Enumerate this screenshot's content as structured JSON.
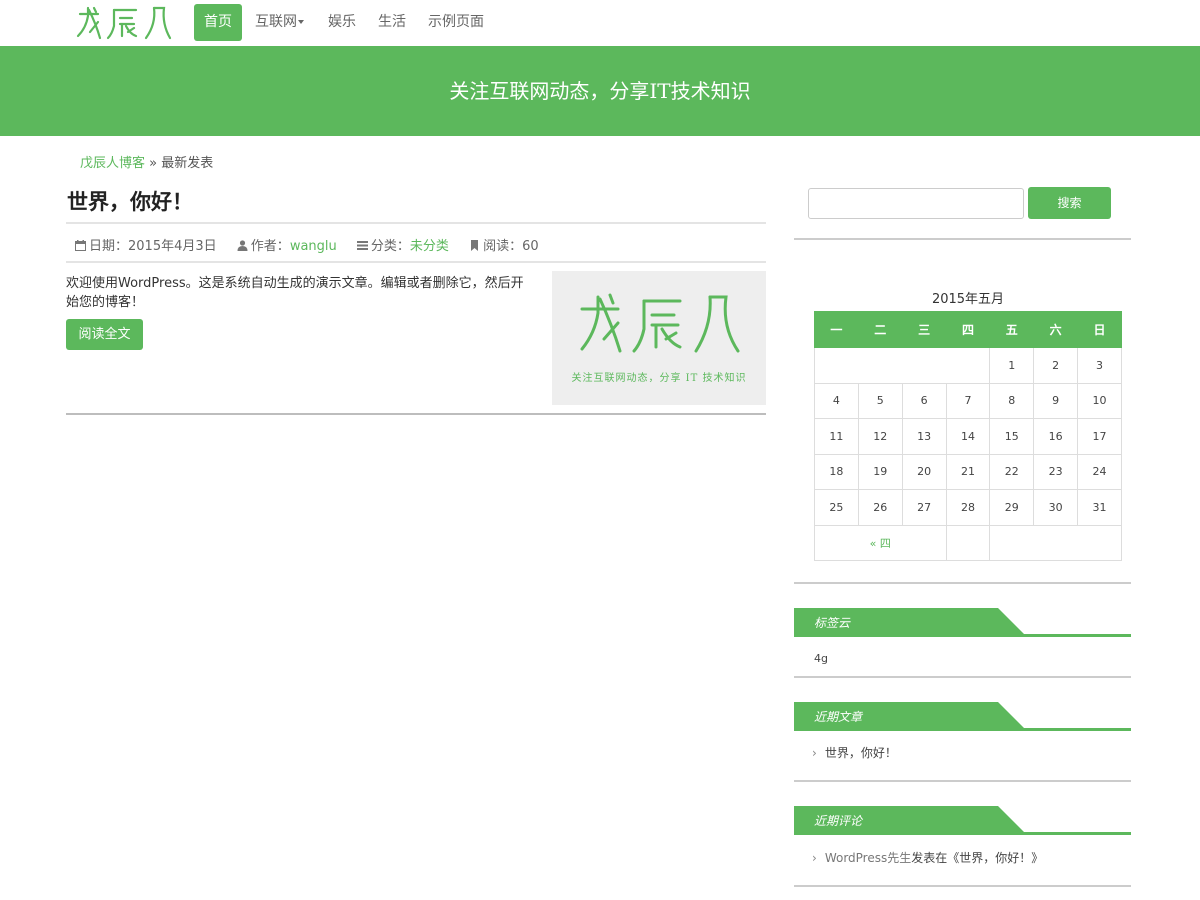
{
  "brand": {
    "logo_alt": "戊辰人",
    "accent": "#5cb85c"
  },
  "nav": {
    "items": [
      {
        "label": "首页"
      },
      {
        "label": "互联网"
      },
      {
        "label": "娱乐"
      },
      {
        "label": "生活"
      },
      {
        "label": "示例页面"
      }
    ]
  },
  "banner": {
    "slogan": "关注互联网动态，分享IT技术知识"
  },
  "breadcrumb": {
    "home": "戊辰人博客",
    "separator": "»",
    "current": "最新发表"
  },
  "post": {
    "title": "世界，你好！",
    "date_label": "日期：",
    "date": "2015年4月3日",
    "author_label": "作者：",
    "author": "wanglu",
    "category_label": "分类：",
    "category": "未分类",
    "views_label": "阅读：",
    "views": "60",
    "excerpt": "欢迎使用WordPress。这是系统自动生成的演示文章。编辑或者删除它，然后开始您的博客！",
    "read_more": "阅读全文",
    "thumb_slogan": "关注互联网动态，分享 IT 技术知识"
  },
  "sidebar": {
    "search": {
      "placeholder": "",
      "button": "搜索"
    },
    "calendar": {
      "caption": "2015年五月",
      "weekdays": [
        "一",
        "二",
        "三",
        "四",
        "五",
        "六",
        "日"
      ],
      "weeks": [
        [
          "",
          "",
          "",
          "",
          "1",
          "2",
          "3"
        ],
        [
          "4",
          "5",
          "6",
          "7",
          "8",
          "9",
          "10"
        ],
        [
          "11",
          "12",
          "13",
          "14",
          "15",
          "16",
          "17"
        ],
        [
          "18",
          "19",
          "20",
          "21",
          "22",
          "23",
          "24"
        ],
        [
          "25",
          "26",
          "27",
          "28",
          "29",
          "30",
          "31"
        ]
      ],
      "prev_link": "« 四"
    },
    "tag_cloud": {
      "title": "标签云",
      "tags": [
        "4g"
      ]
    },
    "recent_posts": {
      "title": "近期文章",
      "items": [
        "世界，你好！"
      ]
    },
    "recent_comments": {
      "title": "近期评论",
      "author": "WordPress先生",
      "text": "发表在《世界，你好！》"
    }
  }
}
